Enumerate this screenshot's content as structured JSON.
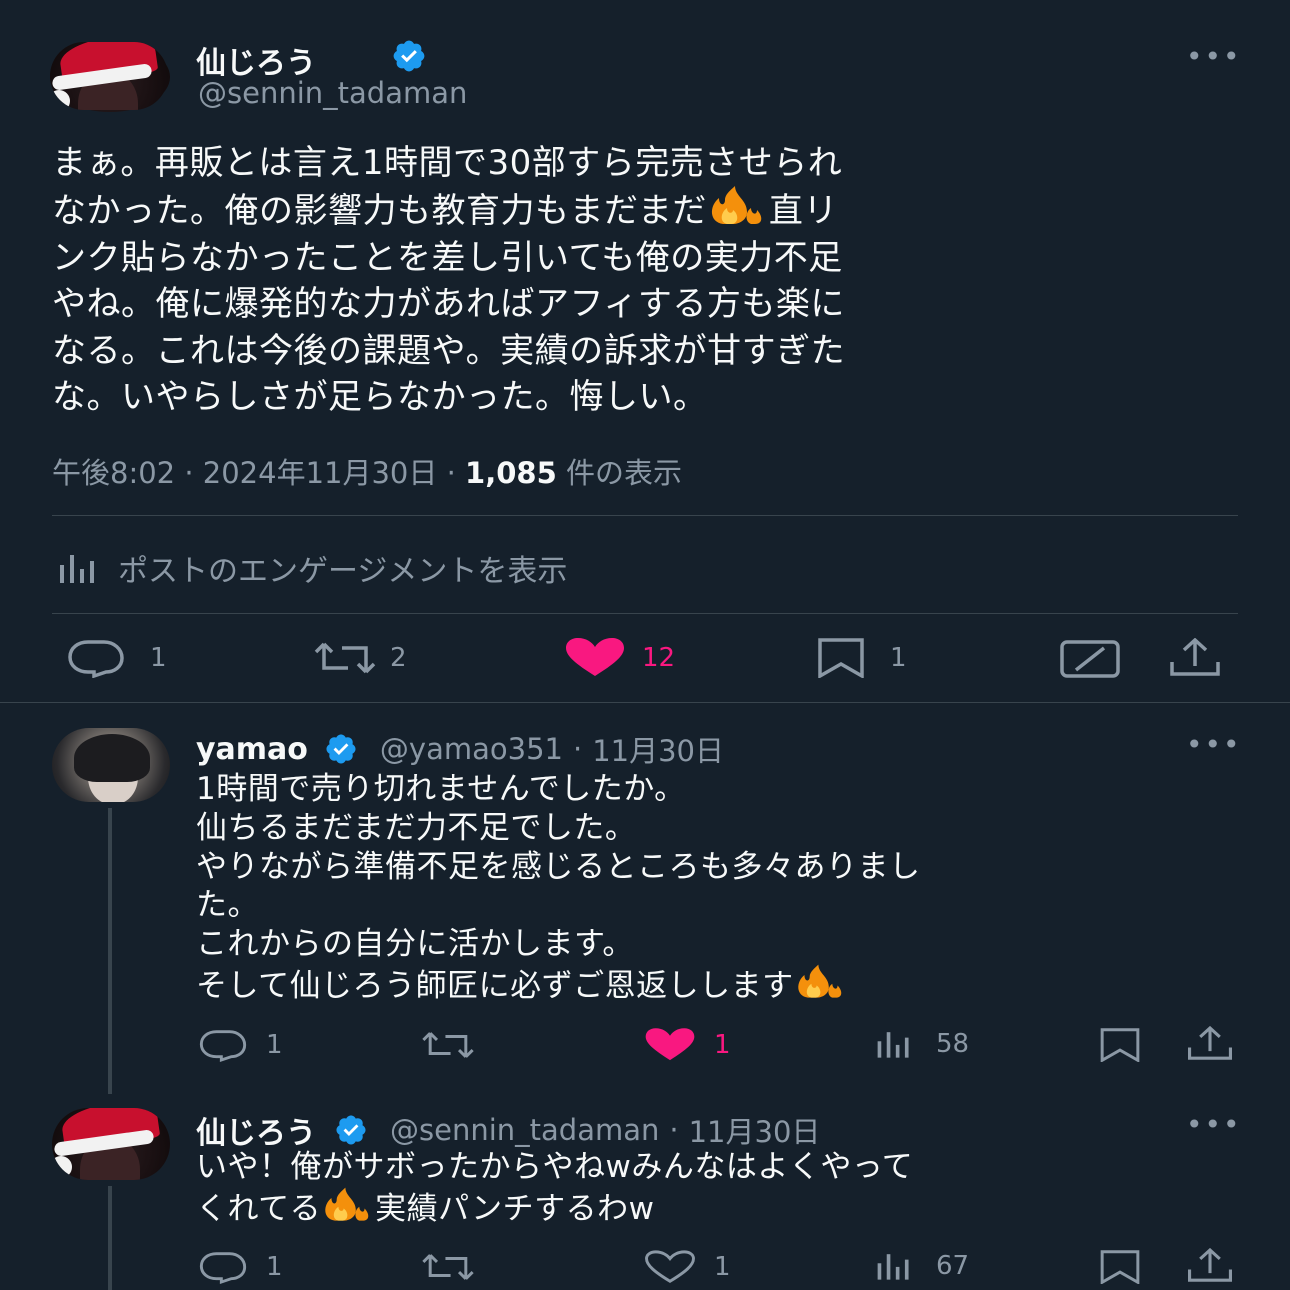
{
  "main_post": {
    "display_name": "仙じろう",
    "handle": "@sennin_tadaman",
    "text_lines": [
      "まぁ。再販とは言え1時間で30部すら完売させられ",
      "なかった。俺の影響力も教育力もまだまだ",
      "ンク貼らなかったことを差し引いても俺の実力不足",
      "やね。俺に爆発的な力があればアフィする方も楽に",
      "なる。これは今後の課題や。実績の訴求が甘すぎた",
      "な。いやらしさが足らなかった。悔しい。"
    ],
    "line2_tail": "直リ",
    "time": "午後8:02",
    "date": "2024年11月30日",
    "views_count": "1,085",
    "views_label": "件の表示",
    "engagement_label": "ポストのエンゲージメントを表示",
    "actions": {
      "replies": "1",
      "reposts": "2",
      "likes": "12",
      "bookmarks": "1"
    }
  },
  "reply1": {
    "display_name": "yamao",
    "handle": "@yamao351",
    "date": "11月30日",
    "text_lines": [
      "1時間で売り切れませんでしたか。",
      "仙ちるまだまだ力不足でした。",
      "やりながら準備不足を感じるところも多々ありまし",
      "た。",
      "これからの自分に活かします。",
      "そして仙じろう師匠に必ずご恩返しします"
    ],
    "actions": {
      "replies": "1",
      "likes": "1",
      "views": "58"
    }
  },
  "reply2": {
    "display_name": "仙じろう",
    "handle": "@sennin_tadaman",
    "date": "11月30日",
    "text_lines": [
      "いや！俺がサボったからやねwみんなはよくやって",
      "くれてる"
    ],
    "line2_tail": "実績パンチするわw",
    "actions": {
      "replies": "1",
      "likes": "1",
      "views": "67"
    }
  },
  "separator": "·",
  "colors": {
    "background": "#15202b",
    "text": "#f7f9f9",
    "muted": "#8b98a5",
    "like": "#f91880",
    "verified": "#1d9bf0",
    "divider": "#38444d"
  }
}
